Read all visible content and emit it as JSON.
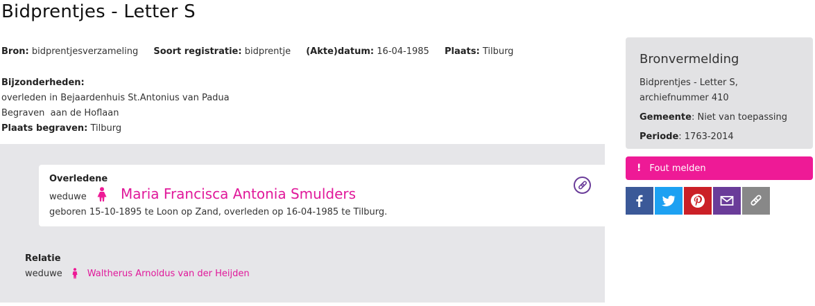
{
  "page": {
    "title": "Bidprentjes - Letter S"
  },
  "meta": [
    {
      "label": "Bron:",
      "value": "bidprentjesverzameling"
    },
    {
      "label": "Soort registratie:",
      "value": "bidprentje"
    },
    {
      "label": "(Akte)datum:",
      "value": "16-04-1985"
    },
    {
      "label": "Plaats:",
      "value": "Tilburg"
    }
  ],
  "details": {
    "heading": "Bijzonderheden:",
    "line1": "overleden in Bejaardenhuis St.Antonius van Padua",
    "line2": "Begraven  aan de Hoflaan",
    "burial_label": "Plaats begraven:",
    "burial_value": "Tilburg"
  },
  "person": {
    "role": "Overledene",
    "status": "weduwe",
    "name": "Maria Francisca Antonia Smulders",
    "life": "geboren 15-10-1895 te Loon op Zand, overleden op 16-04-1985 te Tilburg."
  },
  "relation": {
    "heading": "Relatie",
    "status": "weduwe",
    "name": "Waltherus Arnoldus van der Heijden"
  },
  "sidebar": {
    "title": "Bronvermelding",
    "source": "Bidprentjes - Letter S, archiefnummer 410",
    "gemeente_label": "Gemeente",
    "gemeente_value": ": Niet van toepassing",
    "periode_label": "Periode",
    "periode_value": ": 1763-2014"
  },
  "fout": {
    "icon": "!",
    "label": "Fout melden"
  },
  "share": {
    "icons": [
      "facebook-icon",
      "twitter-icon",
      "pinterest-icon",
      "mail-icon",
      "link-icon"
    ]
  },
  "colors": {
    "accent_pink": "#ee1a96",
    "name_pink": "#e0189a",
    "purple": "#6a3c99",
    "panel_grey": "#e6e6e9",
    "facebook": "#3b5998",
    "twitter": "#1da1f2",
    "pinterest": "#cb2027",
    "mail": "#6a3c99",
    "copy": "#888888"
  }
}
